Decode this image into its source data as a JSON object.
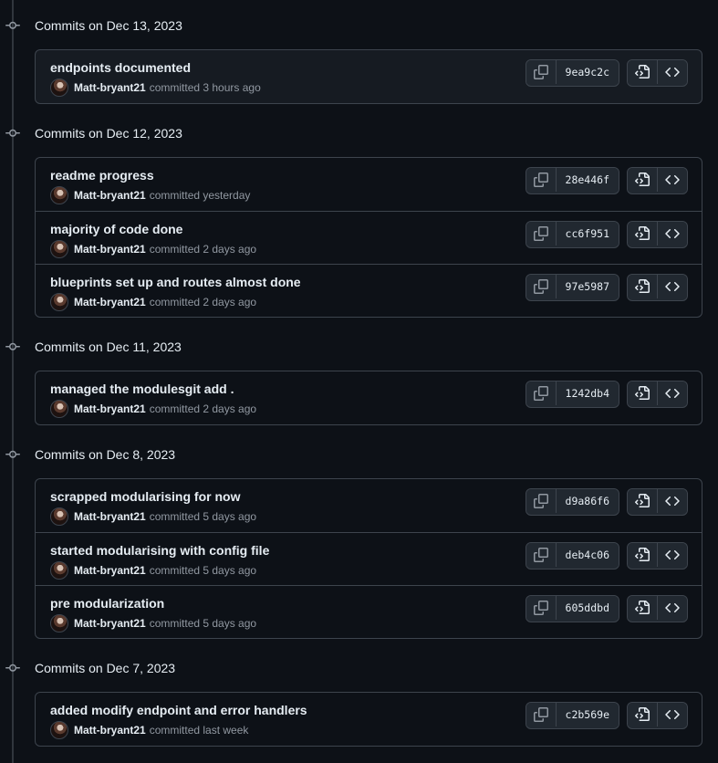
{
  "groups": [
    {
      "title": "Commits on Dec 13, 2023",
      "commits": [
        {
          "message": "endpoints documented",
          "author": "Matt-bryant21",
          "time": "committed 3 hours ago",
          "sha": "9ea9c2c"
        }
      ]
    },
    {
      "title": "Commits on Dec 12, 2023",
      "commits": [
        {
          "message": "readme progress",
          "author": "Matt-bryant21",
          "time": "committed yesterday",
          "sha": "28e446f"
        },
        {
          "message": "majority of code done",
          "author": "Matt-bryant21",
          "time": "committed 2 days ago",
          "sha": "cc6f951"
        },
        {
          "message": "blueprints set up and routes almost done",
          "author": "Matt-bryant21",
          "time": "committed 2 days ago",
          "sha": "97e5987"
        }
      ]
    },
    {
      "title": "Commits on Dec 11, 2023",
      "commits": [
        {
          "message": "managed the modulesgit add .",
          "author": "Matt-bryant21",
          "time": "committed 2 days ago",
          "sha": "1242db4"
        }
      ]
    },
    {
      "title": "Commits on Dec 8, 2023",
      "commits": [
        {
          "message": "scrapped modularising for now",
          "author": "Matt-bryant21",
          "time": "committed 5 days ago",
          "sha": "d9a86f6"
        },
        {
          "message": "started modularising with config file",
          "author": "Matt-bryant21",
          "time": "committed 5 days ago",
          "sha": "deb4c06"
        },
        {
          "message": "pre modularization",
          "author": "Matt-bryant21",
          "time": "committed 5 days ago",
          "sha": "605ddbd"
        }
      ]
    },
    {
      "title": "Commits on Dec 7, 2023",
      "commits": [
        {
          "message": "added modify endpoint and error handlers",
          "author": "Matt-bryant21",
          "time": "committed last week",
          "sha": "c2b569e"
        }
      ]
    }
  ],
  "icons": {
    "commit_node": "git-commit-icon",
    "copy": "copy-icon",
    "browse_files": "file-code-icon",
    "browse_repo": "code-icon"
  },
  "colors": {
    "background": "#0d1117",
    "border": "#3d444d",
    "text": "#e6edf3",
    "muted": "#9198a1"
  }
}
